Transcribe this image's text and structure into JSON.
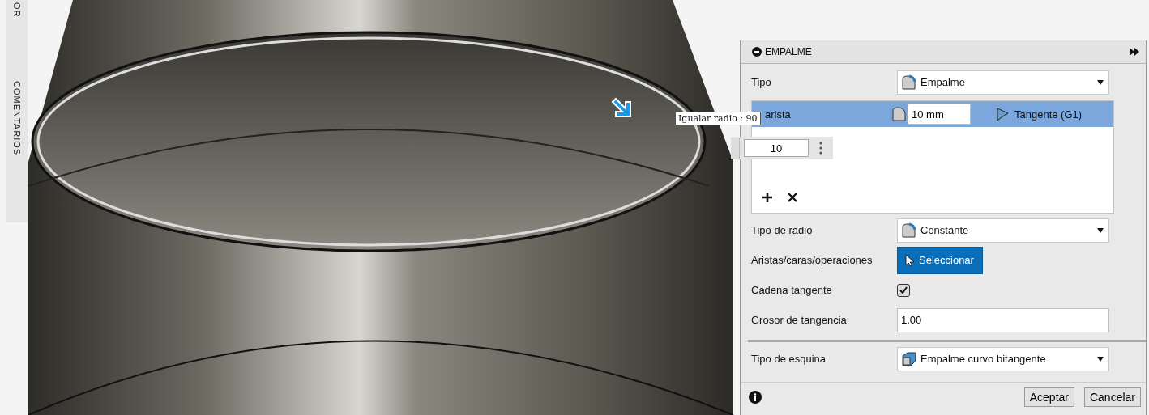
{
  "sidebar": {
    "labels": [
      "OR",
      "COMENTARIOS"
    ]
  },
  "viewport": {
    "tooltip": "Igualar radio : 90",
    "radius_input": {
      "value": "10"
    }
  },
  "panel": {
    "title": "EMPALME",
    "type_row": {
      "label": "Tipo",
      "value": "Empalme"
    },
    "edges": [
      {
        "name": "arista",
        "radius": "10 mm",
        "continuity": "Tangente (G1)",
        "selected": true
      }
    ],
    "fields": [
      {
        "kind": "dropdown",
        "label": "Tipo de radio",
        "value": "Constante"
      },
      {
        "kind": "select",
        "label": "Aristas/caras/operaciones",
        "value": "Seleccionar"
      },
      {
        "kind": "checkbox",
        "label": "Cadena tangente",
        "checked": true
      },
      {
        "kind": "text",
        "label": "Grosor de tangencia",
        "value": "1.00"
      }
    ],
    "corner": {
      "label": "Tipo de esquina",
      "value": "Empalme curvo bitangente"
    }
  },
  "buttons": [
    "Aceptar",
    "Cancelar"
  ]
}
